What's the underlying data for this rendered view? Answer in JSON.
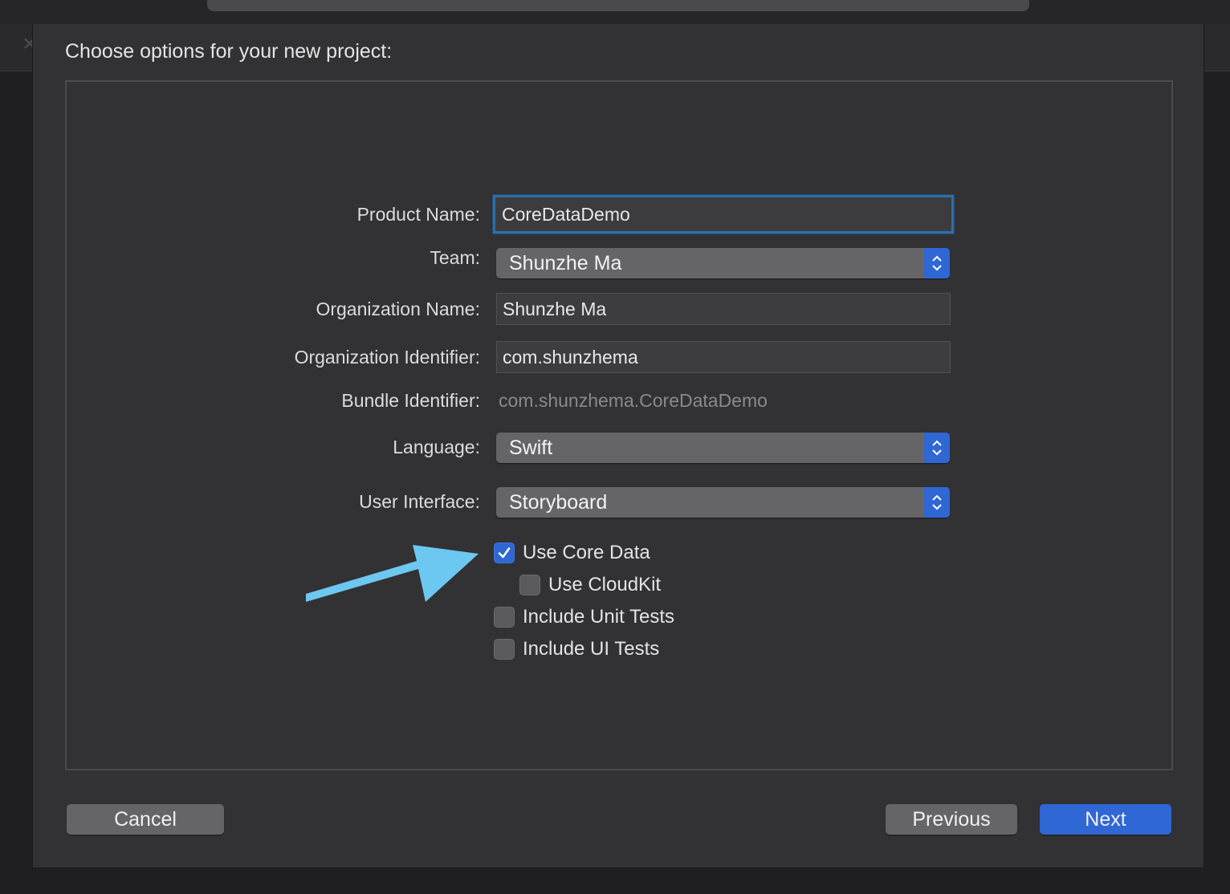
{
  "sheet": {
    "title": "Choose options for your new project:"
  },
  "form": {
    "product_name": {
      "label": "Product Name:",
      "value": "CoreDataDemo"
    },
    "team": {
      "label": "Team:",
      "value": "Shunzhe Ma"
    },
    "organization_name": {
      "label": "Organization Name:",
      "value": "Shunzhe Ma"
    },
    "organization_identifier": {
      "label": "Organization Identifier:",
      "value": "com.shunzhema"
    },
    "bundle_identifier": {
      "label": "Bundle Identifier:",
      "value": "com.shunzhema.CoreDataDemo"
    },
    "language": {
      "label": "Language:",
      "value": "Swift"
    },
    "user_interface": {
      "label": "User Interface:",
      "value": "Storyboard"
    }
  },
  "options": [
    {
      "label": "Use Core Data",
      "checked": true
    },
    {
      "label": "Use CloudKit",
      "checked": false
    },
    {
      "label": "Include Unit Tests",
      "checked": false
    },
    {
      "label": "Include UI Tests",
      "checked": false
    }
  ],
  "buttons": {
    "cancel": "Cancel",
    "previous": "Previous",
    "next": "Next"
  },
  "colors": {
    "accent": "#2f67d4",
    "annotation_arrow": "#6cc8f0",
    "sheet_background": "#323234"
  },
  "icons": {
    "popup": "chevron-up-down-icon",
    "check": "checkmark-icon",
    "annotation": "arrow-annotation"
  }
}
